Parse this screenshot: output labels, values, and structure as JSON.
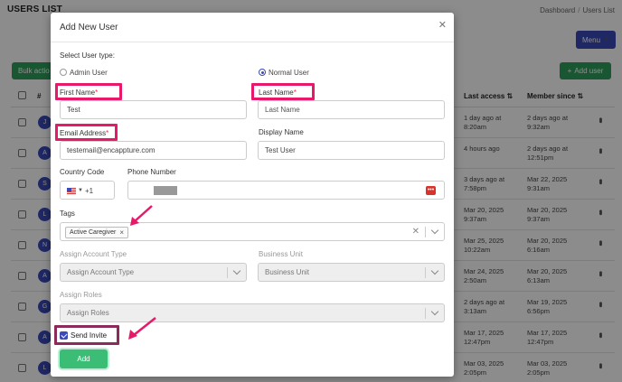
{
  "background": {
    "page_title": "USERS LIST",
    "breadcrumb": [
      "Dashboard",
      "Users List"
    ],
    "menu_button": "Menu",
    "bulk_button": "Bulk actio",
    "add_user_button": "Add user",
    "add_user_icon": "plus-icon",
    "columns": {
      "hash": "#",
      "last_access": "Last access",
      "member_since": "Member since"
    },
    "rows": [
      {
        "initial": "J",
        "last_access": [
          "1 day ago at",
          "8:20am"
        ],
        "member_since": [
          "2 days ago at",
          "9:32am"
        ]
      },
      {
        "initial": "A",
        "last_access": [
          "4 hours ago",
          ""
        ],
        "member_since": [
          "2 days ago at",
          "12:51pm"
        ]
      },
      {
        "initial": "S",
        "last_access": [
          "3 days ago at",
          "7:58pm"
        ],
        "member_since": [
          "Mar 22, 2025",
          "9:31am"
        ]
      },
      {
        "initial": "L",
        "last_access": [
          "Mar 20, 2025",
          "9:37am"
        ],
        "member_since": [
          "Mar 20, 2025",
          "9:37am"
        ]
      },
      {
        "initial": "N",
        "last_access": [
          "Mar 25, 2025",
          "10:22am"
        ],
        "member_since": [
          "Mar 20, 2025",
          "6:16am"
        ]
      },
      {
        "initial": "A",
        "last_access": [
          "Mar 24, 2025",
          "2:50am"
        ],
        "member_since": [
          "Mar 20, 2025",
          "6:13am"
        ]
      },
      {
        "initial": "G",
        "last_access": [
          "2 days ago at",
          "3:13am"
        ],
        "member_since": [
          "Mar 19, 2025",
          "6:56pm"
        ]
      },
      {
        "initial": "A",
        "last_access": [
          "Mar 17, 2025",
          "12:47pm"
        ],
        "member_since": [
          "Mar 17, 2025",
          "12:47pm"
        ]
      },
      {
        "initial": "L",
        "last_access": [
          "Mar 03, 2025",
          "2:05pm"
        ],
        "member_since": [
          "Mar 03, 2025",
          "2:05pm"
        ]
      }
    ]
  },
  "modal": {
    "title": "Add New User",
    "close_icon": "close-icon",
    "user_type_label": "Select User type:",
    "user_types": [
      {
        "label": "Admin User",
        "checked": false
      },
      {
        "label": "Normal User",
        "checked": true
      }
    ],
    "first_name": {
      "label": "First Name",
      "required": "*",
      "value": "Test"
    },
    "last_name": {
      "label": "Last Name",
      "required": "*",
      "placeholder": "Last Name"
    },
    "email": {
      "label": "Email Address",
      "required": "*",
      "value": "testemail@encappture.com"
    },
    "display_name": {
      "label": "Display Name",
      "value": "Test User"
    },
    "country_code": {
      "label": "Country Code",
      "value": "+1",
      "flag_icon": "us-flag-icon"
    },
    "phone": {
      "label": "Phone Number",
      "badge_icon": "password-manager-icon"
    },
    "tags": {
      "label": "Tags",
      "chips": [
        "Active Caregiver"
      ]
    },
    "account_type": {
      "label": "Assign Account Type",
      "placeholder": "Assign Account Type"
    },
    "business_unit": {
      "label": "Business Unit",
      "placeholder": "Business Unit"
    },
    "roles": {
      "label": "Assign Roles",
      "placeholder": "Assign Roles"
    },
    "send_invite": {
      "label": "Send Invite",
      "checked": true
    },
    "submit_button": "Add"
  },
  "colors": {
    "highlight": "#e8196b",
    "highlight_dark": "#8c2a5c",
    "primary": "#3a4ab8",
    "success": "#3cbd76"
  }
}
